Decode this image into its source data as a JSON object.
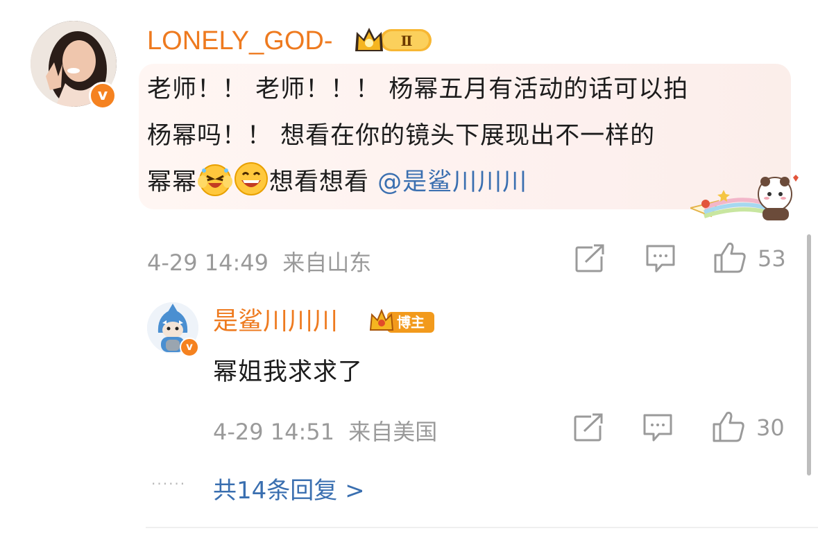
{
  "comment": {
    "username": "LONELY_GOD-",
    "badge_level": "Ⅱ",
    "text_line1": "老师！！ 老师！！！ 杨幂五月有活动的话可以拍",
    "text_line2": "杨幂吗！！ 想看在你的镜头下展现出不一样的",
    "text_line3_prefix": "幂幂",
    "text_line3_suffix": "想看想看",
    "mention": "@是鲨川川川",
    "time": "4-29 14:49",
    "location": "来自山东",
    "likes": "53"
  },
  "reply": {
    "username": "是鲨川川川",
    "badge_label": "博主",
    "text": "幂姐我求求了",
    "time": "4-29 14:51",
    "location": "来自美国",
    "likes": "30"
  },
  "more_replies": "共14条回复 >",
  "colors": {
    "username": "#ee7a1f",
    "link": "#3a6fb0",
    "meta": "#9a9a9a",
    "verified": "#f58220"
  }
}
